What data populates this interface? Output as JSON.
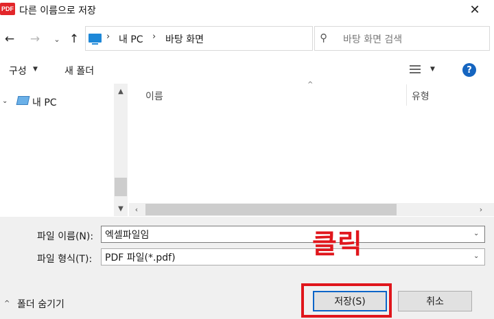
{
  "window": {
    "app_icon_text": "PDF",
    "title": "다른 이름으로 저장",
    "close_glyph": "✕"
  },
  "nav": {
    "back_icon": "arrow-left-icon",
    "forward_icon": "arrow-right-icon",
    "recent_icon": "chevron-down-icon",
    "up_icon": "arrow-up-icon",
    "breadcrumbs": [
      "내 PC",
      "바탕 화면"
    ],
    "search_placeholder": "바탕 화면 검색"
  },
  "toolbar": {
    "organize_label": "구성",
    "new_folder_label": "새 폴더",
    "help_label": "?"
  },
  "tree": {
    "items": [
      {
        "label": "내 PC",
        "icon": "computer-icon"
      }
    ]
  },
  "file_list": {
    "columns": [
      "이름",
      "유형"
    ],
    "rows": []
  },
  "form": {
    "filename_label": "파일 이름(N):",
    "filename_value": "엑셀파일임",
    "filetype_label": "파일 형식(T):",
    "filetype_value": "PDF 파일(*.pdf)"
  },
  "footer": {
    "hide_folders_label": "폴더 숨기기",
    "save_label": "저장(S)",
    "cancel_label": "취소"
  },
  "annotation": {
    "text": "클릭",
    "color": "#e0161c"
  },
  "colors": {
    "accent": "#0a64c8",
    "help_badge": "#1565c0",
    "dialog_bottom_bg": "#f0f0f0"
  }
}
